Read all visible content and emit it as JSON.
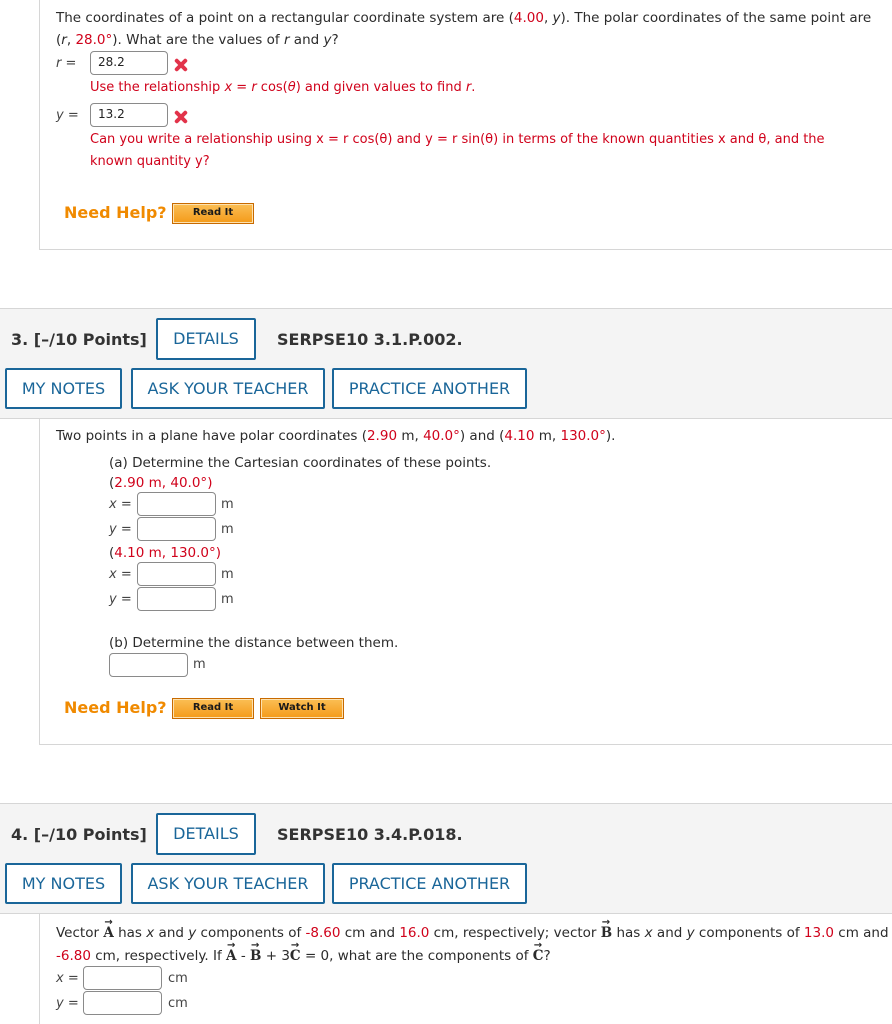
{
  "q2": {
    "line1_a": "The coordinates of a point on a rectangular coordinate system are (",
    "x_val": "4.00",
    "line1_b": ", ",
    "y_var": "y",
    "line1_c": "). The polar coordinates of the same point are",
    "line2_a": "(",
    "r_var": "r",
    "line2_b": ", ",
    "theta_val": "28.0°",
    "line2_c": "). What are the values of ",
    "line2_r": "r",
    "line2_d": " and ",
    "line2_y": "y",
    "line2_e": "?",
    "r_label": "r =",
    "r_value": "28.2",
    "hint1_a": "Use the relationship ",
    "hint1_x": "x",
    "hint1_b": " = ",
    "hint1_r": "r",
    "hint1_c": " cos(",
    "hint1_t": "θ",
    "hint1_d": ") and given values to find ",
    "hint1_r2": "r",
    "hint1_e": ".",
    "y_label": "y =",
    "y_value": "13.2",
    "hint2_line1": "Can you write a relationship using x = r cos(θ) and y = r sin(θ) in terms of the known quantities x and θ, and the",
    "hint2_line2": "known quantity y?",
    "need_help": "Need Help?",
    "read_it": "Read It"
  },
  "q3": {
    "number_label": "3.  [–/10 Points]",
    "details": "DETAILS",
    "code": "SERPSE10 3.1.P.002.",
    "my_notes": "MY NOTES",
    "ask_teacher": "ASK YOUR TEACHER",
    "practice": "PRACTICE ANOTHER",
    "intro_a": "Two points in a plane have polar coordinates (",
    "p1": "2.90",
    "intro_b": " m, ",
    "a1": "40.0°",
    "intro_c": ") and (",
    "p2": "4.10",
    "intro_d": " m, ",
    "a2": "130.0°",
    "intro_e": ").",
    "part_a": "(a) Determine the Cartesian coordinates of these points.",
    "pt1_a": "(",
    "pt1_r": "2.90",
    "pt1_b": " m, ",
    "pt1_t": "40.0°",
    "pt1_c": ")",
    "x_label": "x =",
    "y_label": "y =",
    "unit": "m",
    "pt2_a": "(",
    "pt2_r": "4.10",
    "pt2_b": " m, ",
    "pt2_t": "130.0°",
    "pt2_c": ")",
    "part_b": "(b) Determine the distance between them.",
    "need_help": "Need Help?",
    "read_it": "Read It",
    "watch_it": "Watch It"
  },
  "q4": {
    "number_label": "4.  [–/10 Points]",
    "details": "DETAILS",
    "code": "SERPSE10 3.4.P.018.",
    "my_notes": "MY NOTES",
    "ask_teacher": "ASK YOUR TEACHER",
    "practice": "PRACTICE ANOTHER",
    "t1": "Vector ",
    "A": "A",
    "t2": " has ",
    "t2x": "x",
    "t3": " and ",
    "t3y": "y",
    "t4": " components of ",
    "ax": "-8.60",
    "t5": " cm and ",
    "ay": "16.0",
    "t6": " cm, respectively; vector ",
    "B": "B",
    "t7": " has ",
    "t7x": "x",
    "t8": " and ",
    "t8y": "y",
    "t9": " components of ",
    "bx": "13.0",
    "t10": " cm and",
    "by": "-6.80",
    "t11": " cm, respectively. If ",
    "A2": "A",
    "t12": " - ",
    "B2": "B",
    "t13": " + 3",
    "C": "C",
    "t14": " = 0, what are the components of ",
    "C2": "C",
    "t15": "?",
    "x_label": "x =",
    "y_label": "y =",
    "unit": "cm"
  }
}
